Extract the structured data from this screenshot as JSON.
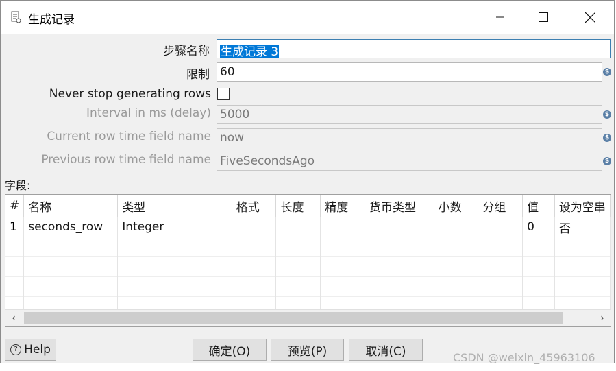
{
  "window": {
    "title": "生成记录",
    "controls": {
      "minimize": "—",
      "maximize": "☐",
      "close": "✕"
    }
  },
  "form": {
    "step_name": {
      "label": "步骤名称",
      "value_selected": "生成记录 3"
    },
    "limit": {
      "label": "限制",
      "value": "60"
    },
    "never_stop": {
      "label": "Never stop generating rows",
      "checked": false
    },
    "interval": {
      "label": "Interval in ms (delay)",
      "value": "5000"
    },
    "current_time_field": {
      "label": "Current row time field name",
      "value": "now"
    },
    "previous_time_field": {
      "label": "Previous row time field name",
      "value": "FiveSecondsAgo"
    },
    "variable_icon": "$"
  },
  "fields": {
    "label": "字段:",
    "columns": [
      "#",
      "名称",
      "类型",
      "格式",
      "长度",
      "精度",
      "货币类型",
      "小数",
      "分组",
      "值",
      "设为空串"
    ],
    "rows": [
      [
        "1",
        "seconds_row",
        "Integer",
        "",
        "",
        "",
        "",
        "",
        "",
        "0",
        "否"
      ]
    ],
    "scroll_left": "‹",
    "scroll_right": "›"
  },
  "buttons": {
    "help": "Help",
    "help_icon": "?",
    "ok": "确定(O)",
    "preview": "预览(P)",
    "cancel": "取消(C)"
  },
  "watermark": "CSDN @weixin_45963106"
}
